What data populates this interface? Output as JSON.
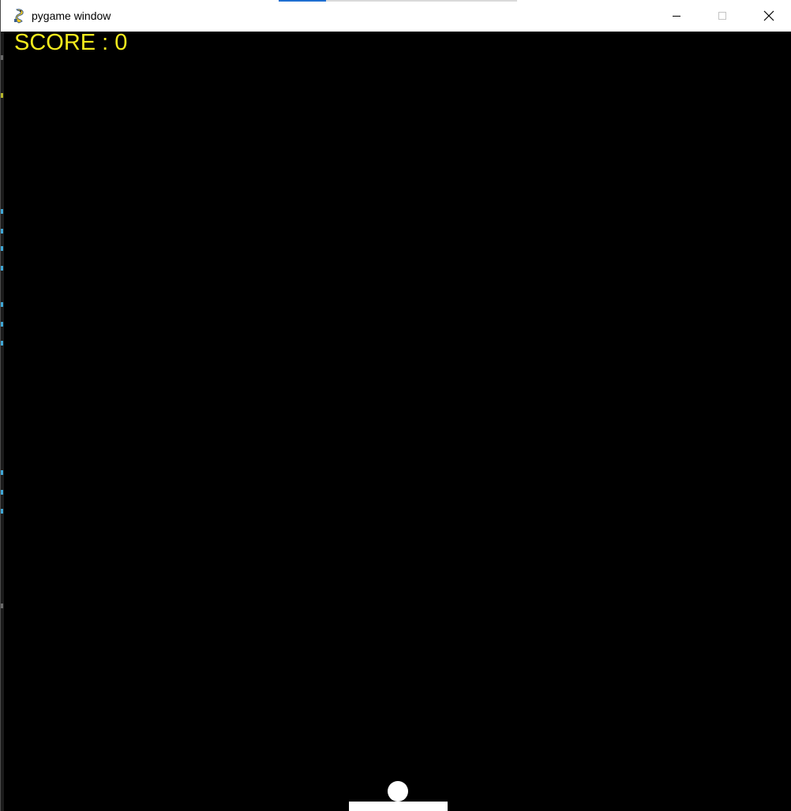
{
  "window": {
    "title": "pygame window",
    "icon": "pygame-snake-icon",
    "controls": {
      "minimize_icon": "minimize-icon",
      "maximize_icon": "maximize-icon",
      "close_icon": "close-icon"
    }
  },
  "game": {
    "background_color": "#000000",
    "score_label": "SCORE : 0",
    "score_color": "#f2ea1d",
    "ball_color": "#ffffff",
    "paddle_color": "#ffffff"
  }
}
